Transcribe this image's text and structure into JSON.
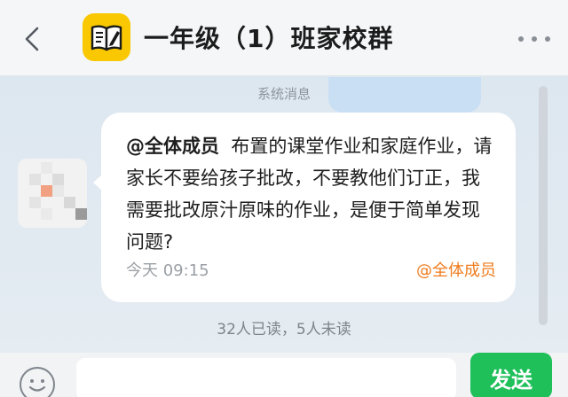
{
  "header": {
    "title": "一年级（1）班家校群",
    "back_icon": "chevron-left-icon",
    "logo_icon": "notebook-pencil-icon",
    "more_icon": "more-dots-icon"
  },
  "chat": {
    "system_label": "系统消息",
    "message": {
      "mention": "@全体成员",
      "body": "布置的课堂作业和家庭作业，请家长不要给孩子批改，不要教他们订正，我需要批改原汁原味的作业，是便于简单发现问题?",
      "time": "今天 09:15",
      "tag": "@全体成员"
    },
    "read_status": "32人已读，5人未读"
  },
  "input_bar": {
    "placeholder": "",
    "send_label": "发送",
    "emoji_icon": "emoji-icon"
  },
  "colors": {
    "logo_bg": "#f9c800",
    "send_bg": "#1fbf5a",
    "tag_color": "#f07b1d"
  }
}
